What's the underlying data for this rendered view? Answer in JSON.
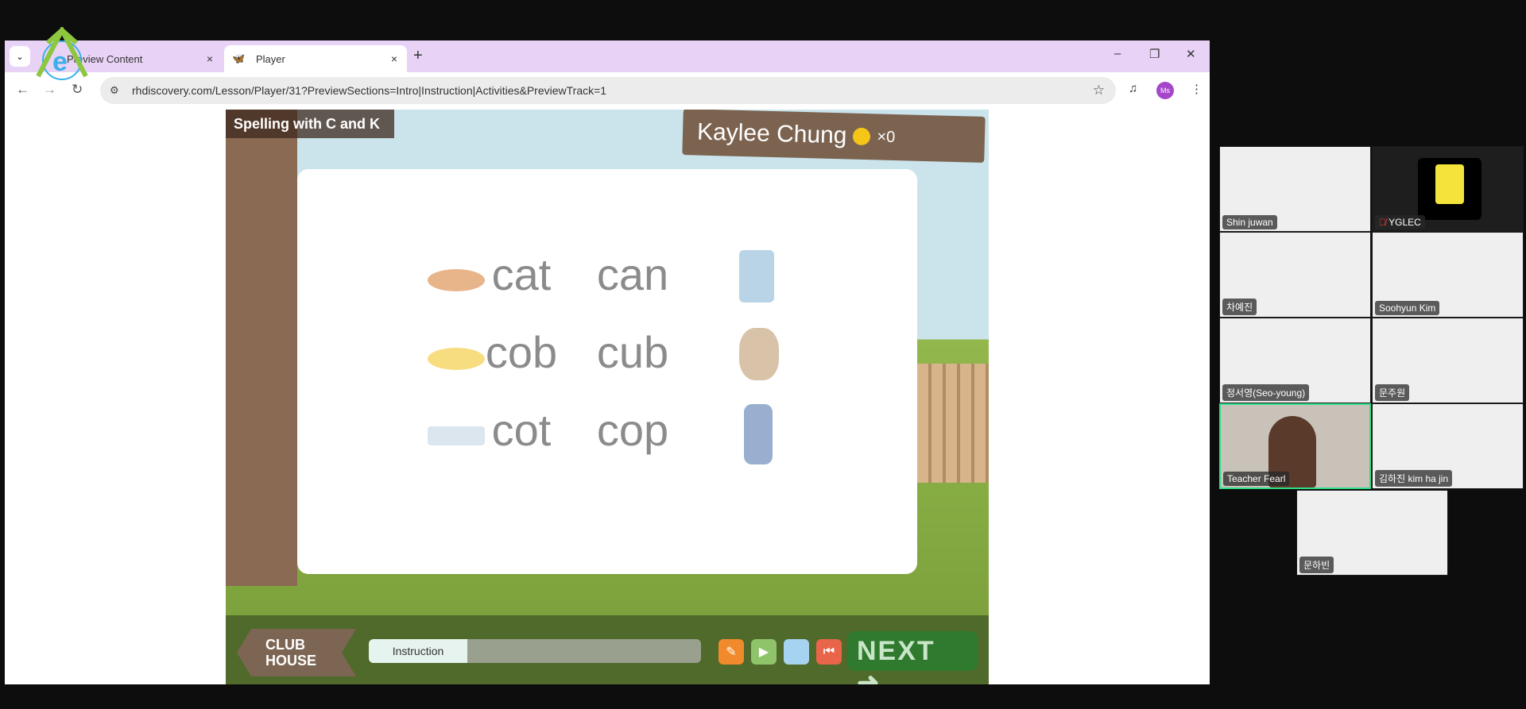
{
  "browser": {
    "tabs": [
      {
        "label": "Preview Content",
        "close": "×"
      },
      {
        "label": "Player",
        "close": "×"
      }
    ],
    "new_tab": "+",
    "url": "rhdiscovery.com/Lesson/Player/31?PreviewSections=Intro|Instruction|Activities&PreviewTrack=1",
    "profile": "Ms",
    "window_controls": [
      "–",
      "❐",
      "✕"
    ]
  },
  "game": {
    "lesson_title": "Spelling with C and K",
    "student_name": "Kaylee Chung",
    "coin_count": "×0",
    "words": [
      {
        "left": "cat",
        "right": "can",
        "left_pic": "roast-chicken",
        "right_pic": "can"
      },
      {
        "left": "cob",
        "right": "cub",
        "left_pic": "corn-cob",
        "right_pic": "bear-cub"
      },
      {
        "left": "cot",
        "right": "cop",
        "left_pic": "cot-bed",
        "right_pic": "police-officer"
      }
    ],
    "club_house_line1": "CLUB",
    "club_house_line2": "HOUSE",
    "progress_section": "Instruction",
    "next_label": "NEXT",
    "colors": {
      "next": "#2f7a2f",
      "orange_btn": "#f08a2c",
      "play_btn": "#8fc46a",
      "blue_btn": "#a6d3ef",
      "rewind_btn": "#e8654a"
    }
  },
  "meeting": {
    "participants": [
      {
        "name": "Shin juwan"
      },
      {
        "name": "YGLEC",
        "muted": true
      },
      {
        "name": "차예진"
      },
      {
        "name": "Soohyun Kim"
      },
      {
        "name": "정서영(Seo-young)"
      },
      {
        "name": "문주원"
      },
      {
        "name": "Teacher Fearl",
        "active_speaker": true
      },
      {
        "name": "김하진  kim ha jin"
      },
      {
        "name": "문하빈"
      }
    ]
  }
}
